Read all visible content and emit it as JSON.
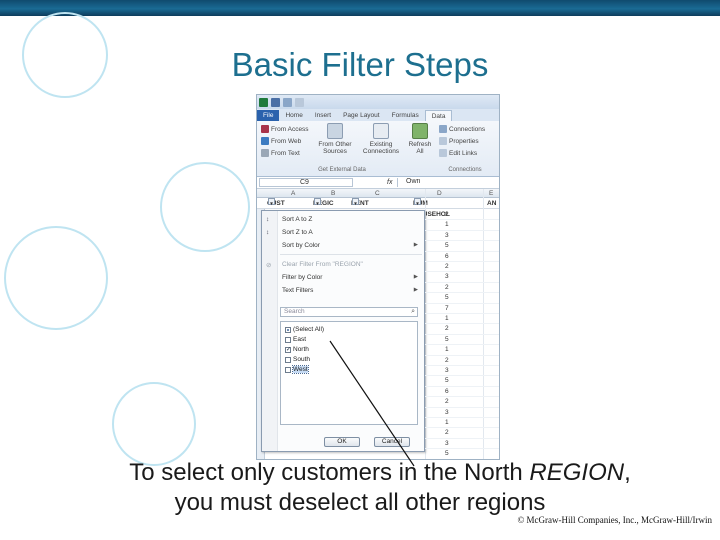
{
  "slide": {
    "title": "Basic Filter Steps",
    "caption_line1_pre": "To select only customers in the North ",
    "caption_line1_em": "REGION",
    "caption_line1_post": ",",
    "caption_line2": "you must deselect all other regions",
    "copyright": "© McGraw-Hill Companies, Inc., McGraw-Hill/Irwin",
    "accent_color": "#1d6f8f",
    "topbar_color": "#1a6b94"
  },
  "excel": {
    "tabs": [
      "File",
      "Home",
      "Insert",
      "Page Layout",
      "Formulas",
      "Data"
    ],
    "active_tab": "Data",
    "ribbon": {
      "from_access": "From Access",
      "from_web": "From Web",
      "from_text": "From Text",
      "from_other_sources": "From Other Sources",
      "existing_connections": "Existing Connections",
      "refresh_all": "Refresh All",
      "connections": "Connections",
      "properties": "Properties",
      "edit_links": "Edit Links",
      "group_external": "Get External Data",
      "group_connections": "Connections"
    },
    "name_box": "C9",
    "formula_fx": "fx",
    "formula_value": "Own",
    "columns": [
      "A",
      "B",
      "C",
      "D",
      "E"
    ],
    "headers": [
      "CUST",
      "REGIC",
      "RENT VS. OV",
      "NUM HOUSEHOL",
      "AN"
    ],
    "row_values": [
      "2",
      "1",
      "3",
      "5",
      "6",
      "2",
      "3",
      "2",
      "5",
      "7",
      "1",
      "2",
      "5",
      "1",
      "2",
      "3",
      "5",
      "6",
      "2",
      "3",
      "1",
      "2",
      "3",
      "5"
    ],
    "filter_menu": {
      "sort_az": "Sort A to Z",
      "sort_za": "Sort Z to A",
      "sort_color": "Sort by Color",
      "clear_filter": "Clear Filter From \"REGION\"",
      "filter_color": "Filter by Color",
      "text_filters": "Text Filters",
      "search_placeholder": "Search",
      "items": [
        {
          "label": "(Select All)",
          "state": "partial"
        },
        {
          "label": "East",
          "state": "unchecked"
        },
        {
          "label": "North",
          "state": "checked"
        },
        {
          "label": "South",
          "state": "unchecked"
        },
        {
          "label": "West",
          "state": "unchecked"
        }
      ],
      "ok_label": "OK",
      "cancel_label": "Cancel"
    }
  }
}
